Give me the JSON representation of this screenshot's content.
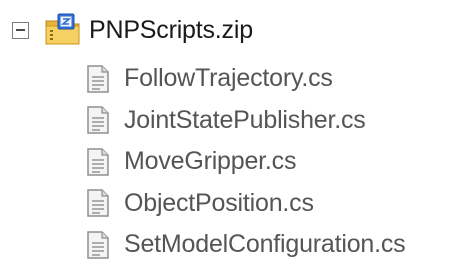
{
  "tree": {
    "root": {
      "label": "PNPScripts.zip",
      "icon": "zip-folder-icon",
      "expanded": true
    },
    "children": [
      {
        "label": "FollowTrajectory.cs",
        "icon": "cs-file-icon"
      },
      {
        "label": "JointStatePublisher.cs",
        "icon": "cs-file-icon"
      },
      {
        "label": "MoveGripper.cs",
        "icon": "cs-file-icon"
      },
      {
        "label": "ObjectPosition.cs",
        "icon": "cs-file-icon"
      },
      {
        "label": "SetModelConfiguration.cs",
        "icon": "cs-file-icon"
      }
    ]
  },
  "colors": {
    "root_text": "#1a1a1a",
    "child_text": "#555555",
    "folder_yellow": "#f2c94c",
    "zip_blue": "#2f6fd6",
    "expander_border": "#7d7d7d"
  }
}
